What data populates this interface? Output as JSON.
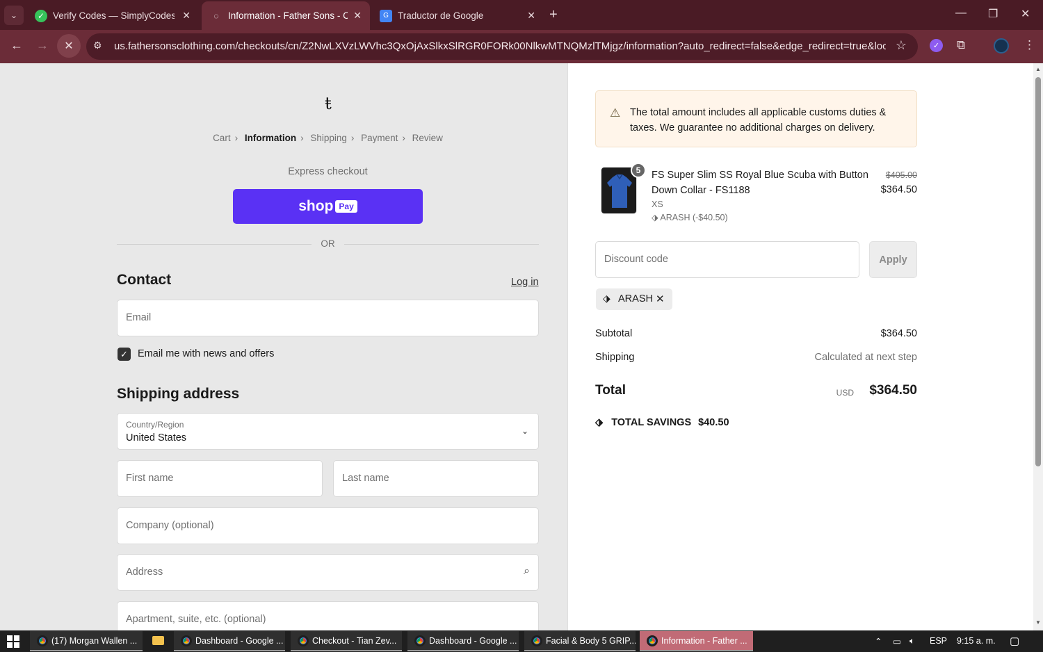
{
  "browser": {
    "tabs": [
      {
        "title": "Verify Codes — SimplyCodes",
        "icon": "simplycodes-icon"
      },
      {
        "title": "Information - Father Sons - Che",
        "icon": "loading-icon"
      },
      {
        "title": "Traductor de Google",
        "icon": "google-translate-icon"
      }
    ],
    "url": "us.fathersonsclothing.com/checkouts/cn/Z2NwLXVzLWVhc3QxOjAxSlkxSlRGR0FORk00NlkwMTNQMzlTMjgz/information?auto_redirect=false&edge_redirect=true&locale=..."
  },
  "checkout": {
    "breadcrumbs": [
      "Cart",
      "Information",
      "Shipping",
      "Payment",
      "Review"
    ],
    "express_label": "Express checkout",
    "shop_label": "shop",
    "pay_label": "Pay",
    "or_label": "OR",
    "contact_heading": "Contact",
    "login_label": "Log in",
    "email_placeholder": "Email",
    "newsletter_label": "Email me with news and offers",
    "newsletter_checked": true,
    "shipping_heading": "Shipping address",
    "country_label": "Country/Region",
    "country_value": "United States",
    "first_name_placeholder": "First name",
    "last_name_placeholder": "Last name",
    "company_placeholder": "Company (optional)",
    "address_placeholder": "Address",
    "apartment_placeholder": "Apartment, suite, etc. (optional)"
  },
  "summary": {
    "notice": "The total amount includes all applicable customs duties & taxes. We guarantee no additional charges on delivery.",
    "product": {
      "quantity": "5",
      "name": "FS Super Slim SS Royal Blue Scuba with Button Down Collar - FS1188",
      "variant": "XS",
      "discount": "ARASH (-$40.50)",
      "old_price": "$405.00",
      "price": "$364.50"
    },
    "discount_placeholder": "Discount code",
    "apply_label": "Apply",
    "applied_code": "ARASH",
    "subtotal_label": "Subtotal",
    "subtotal_value": "$364.50",
    "shipping_label": "Shipping",
    "shipping_value": "Calculated at next step",
    "total_label": "Total",
    "currency": "USD",
    "total_value": "$364.50",
    "savings_label": "TOTAL SAVINGS",
    "savings_value": "$40.50"
  },
  "taskbar": {
    "items": [
      "(17) Morgan Wallen ...",
      "Dashboard - Google ...",
      "Checkout - Tian Zev...",
      "Dashboard - Google ...",
      "Facial & Body 5 GRIP...",
      "Information - Father ..."
    ],
    "language": "ESP",
    "time": "9:15 a. m."
  }
}
